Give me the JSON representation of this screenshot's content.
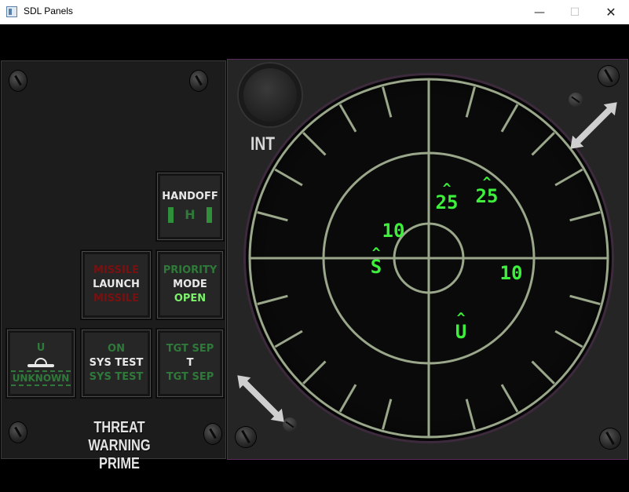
{
  "window": {
    "title": "SDL Panels",
    "minimize_glyph": "—",
    "maximize_glyph": "☐",
    "close_glyph": "✕"
  },
  "left_panel": {
    "buttons": {
      "handoff": {
        "label": "HANDOFF",
        "indicator": "H"
      },
      "missile_launch": {
        "top": "MISSILE",
        "middle": "LAUNCH",
        "bottom": "MISSILE"
      },
      "priority_mode": {
        "top": "PRIORITY",
        "middle": "MODE",
        "bottom": "OPEN"
      },
      "unknown": {
        "top": "U",
        "icon": "unknown-ship-icon",
        "bottom": "UNKNOWN"
      },
      "sys_test": {
        "top": "ON",
        "middle": "SYS TEST",
        "bottom": "SYS TEST"
      },
      "tgt_sep": {
        "top": "TGT SEP",
        "middle": "T",
        "bottom": "TGT SEP"
      }
    },
    "title_line1": "THREAT WARNING",
    "title_line2": "PRIME"
  },
  "right_panel": {
    "int_label": "INT",
    "threats": [
      {
        "id": "t1",
        "label": "25",
        "hat": "^"
      },
      {
        "id": "t2",
        "label": "25",
        "hat": "^"
      },
      {
        "id": "t3",
        "label": "10",
        "hat": ""
      },
      {
        "id": "t4",
        "label": "S",
        "hat": "^"
      },
      {
        "id": "t5",
        "label": "10",
        "hat": ""
      },
      {
        "id": "t6",
        "label": "U",
        "hat": "^"
      }
    ]
  },
  "colors": {
    "symbol_green": "#3cf03c",
    "dim_red": "#7a1010",
    "dim_green": "#2f7a3a",
    "bright_green": "#7cf26a",
    "scope_line": "#9aa78a"
  }
}
